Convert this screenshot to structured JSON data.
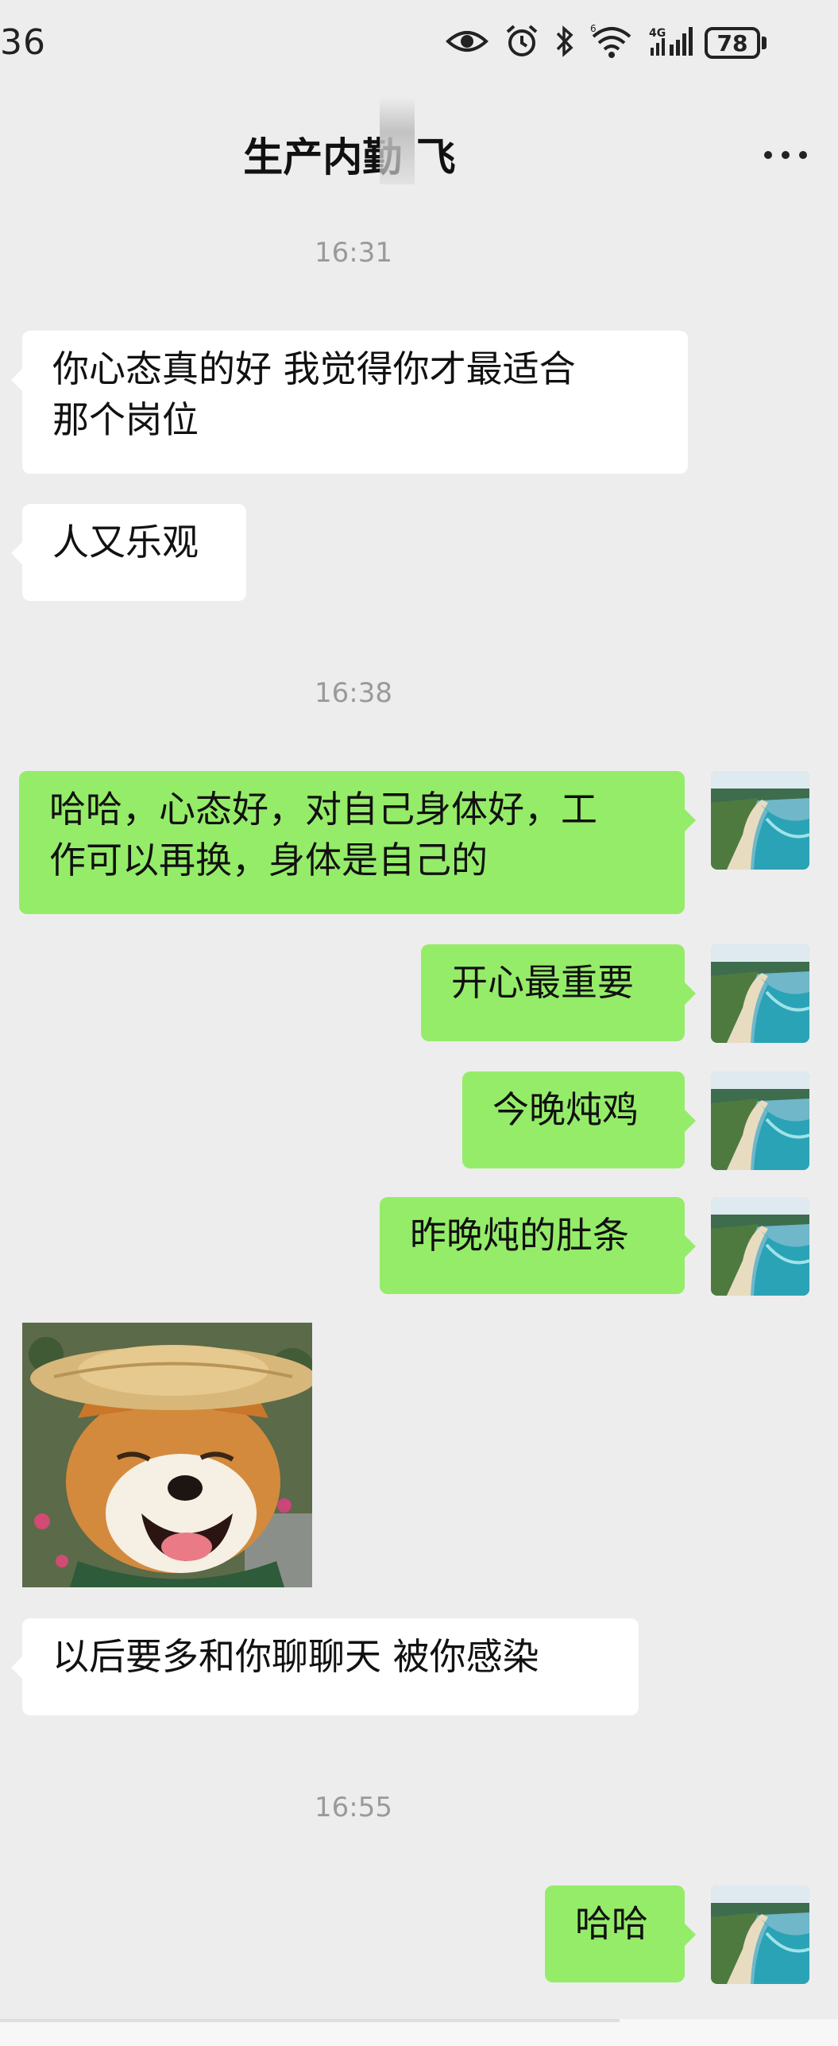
{
  "status_bar": {
    "time": "36",
    "battery": "78"
  },
  "chat": {
    "title": "生产内勤 飞",
    "more_icon": "more-dots-icon"
  },
  "timestamps": [
    "16:31",
    "16:38",
    "16:55"
  ],
  "messages": [
    {
      "side": "in",
      "lines": [
        "你心态真的好  我觉得你才最适合",
        "那个岗位"
      ]
    },
    {
      "side": "in",
      "lines": [
        "人又乐观"
      ]
    },
    {
      "side": "out",
      "lines": [
        "哈哈，心态好，对自己身体好，工",
        "作可以再换，身体是自己的"
      ]
    },
    {
      "side": "out",
      "lines": [
        "开心最重要"
      ]
    },
    {
      "side": "out",
      "lines": [
        "今晚炖鸡"
      ]
    },
    {
      "side": "out",
      "lines": [
        "昨晚炖的肚条"
      ]
    },
    {
      "side": "in",
      "type": "sticker",
      "icon": "shiba-dog-sticker"
    },
    {
      "side": "in",
      "lines": [
        "以后要多和你聊聊天  被你感染"
      ]
    },
    {
      "side": "out",
      "lines": [
        "哈哈"
      ]
    }
  ],
  "colors": {
    "background": "#ededed",
    "incoming": "#ffffff",
    "outgoing": "#95ec69",
    "timestamp": "#9a9a9a"
  }
}
